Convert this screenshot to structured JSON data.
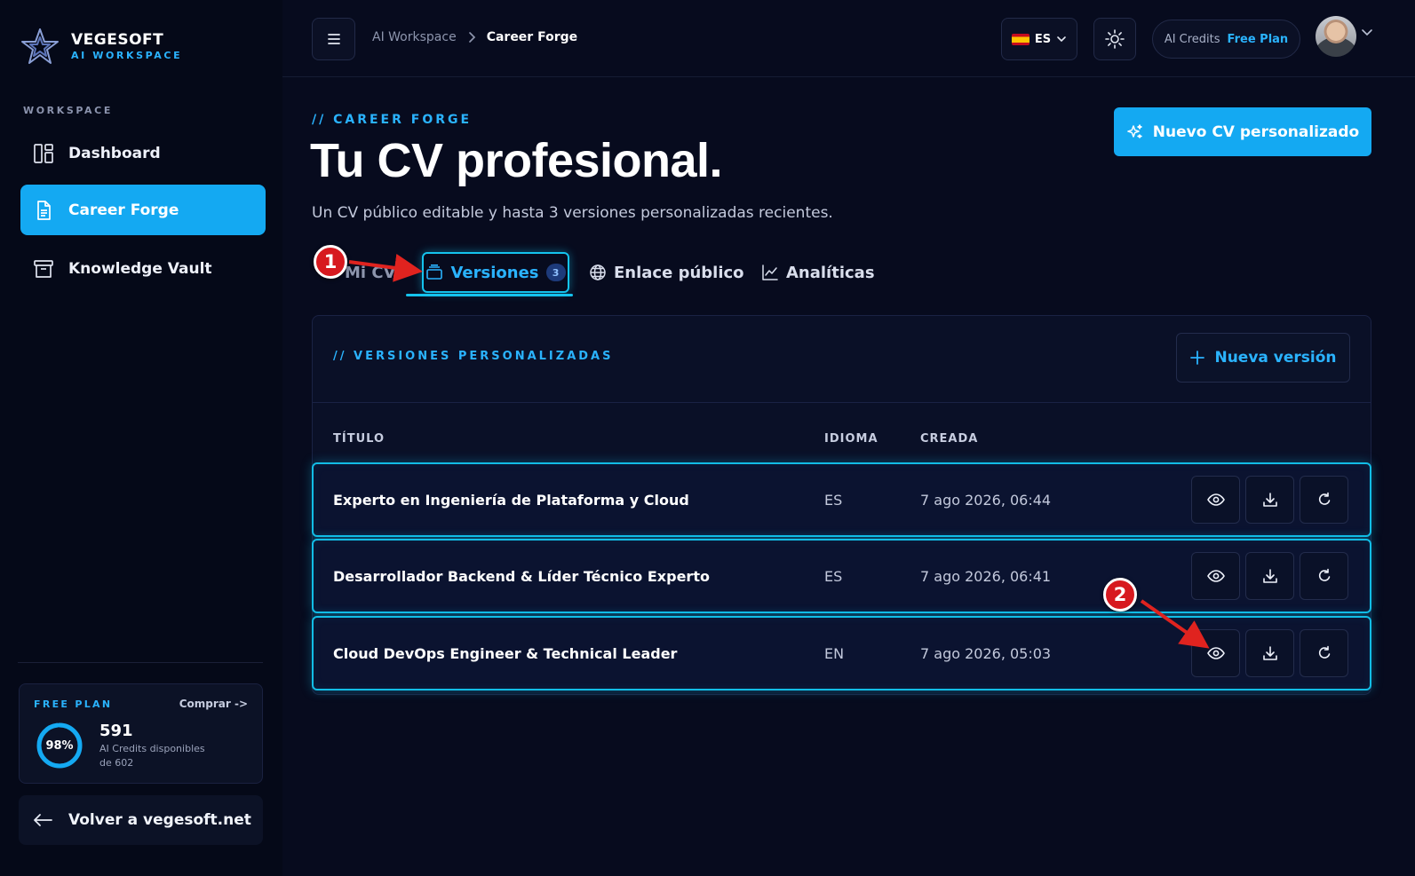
{
  "brand": {
    "name": "VEGESOFT",
    "subtitle": "AI WORKSPACE"
  },
  "sidebar": {
    "section_label": "WORKSPACE",
    "items": [
      {
        "label": "Dashboard",
        "icon": "dashboard-icon",
        "active": false
      },
      {
        "label": "Career Forge",
        "icon": "document-icon",
        "active": true
      },
      {
        "label": "Knowledge Vault",
        "icon": "archive-icon",
        "active": false
      }
    ],
    "plan": {
      "label": "FREE PLAN",
      "buy_label": "Comprar ->",
      "percent_label": "98%",
      "percent": 0.98,
      "credits": "591",
      "credits_desc": "AI Credits disponibles",
      "credits_total": "de 602"
    },
    "back_label": "Volver a vegesoft.net"
  },
  "topbar": {
    "breadcrumb_parent": "AI Workspace",
    "breadcrumb_current": "Career Forge",
    "language": "ES",
    "credits_label": "AI Credits",
    "plan_label": "Free Plan"
  },
  "header": {
    "eyebrow": "// CAREER FORGE",
    "title": "Tu CV profesional.",
    "subtitle": "Un CV público editable y hasta 3 versiones personalizadas recientes.",
    "new_cv_button": "Nuevo CV personalizado"
  },
  "tabs": {
    "my_cv": "Mi CV",
    "versions": "Versiones",
    "versions_count": "3",
    "public_link": "Enlace público",
    "analytics": "Analíticas"
  },
  "versions_panel": {
    "title": "// VERSIONES PERSONALIZADAS",
    "new_version_button": "Nueva versión",
    "columns": {
      "title": "TÍTULO",
      "language": "IDIOMA",
      "created": "CREADA"
    },
    "rows": [
      {
        "title": "Experto en Ingeniería de Plataforma y Cloud",
        "language": "ES",
        "created": "7 ago 2026, 06:44"
      },
      {
        "title": "Desarrollador Backend & Líder Técnico Experto",
        "language": "ES",
        "created": "7 ago 2026, 06:41"
      },
      {
        "title": "Cloud DevOps Engineer & Technical Leader",
        "language": "EN",
        "created": "7 ago 2026, 05:03"
      }
    ]
  },
  "annotations": {
    "step1": "1",
    "step2": "2"
  },
  "colors": {
    "accent": "#14a9f2",
    "link": "#2ab3ff",
    "glow": "#12bde6",
    "marker": "#d7191f",
    "background": "#070b1e"
  }
}
